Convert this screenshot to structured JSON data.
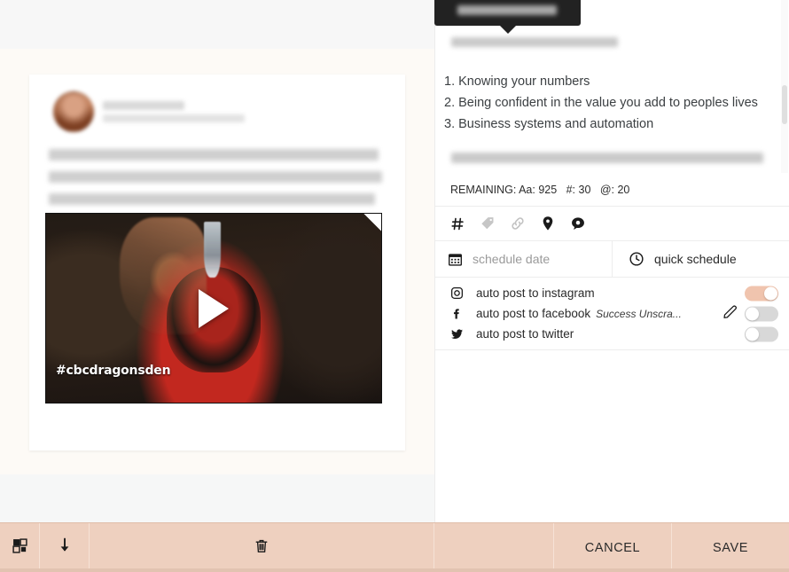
{
  "tooltip": {
    "label": "schedule post",
    "redacted": true
  },
  "left_panel": {
    "post_preview": {
      "author_name_redacted": true,
      "author_handle_redacted": true,
      "body_redacted": true,
      "media": {
        "type": "video",
        "hashtag_overlay": "#cbcdragonsden",
        "play_button": "play-triangle"
      }
    }
  },
  "right_panel": {
    "editor": {
      "intro_line_redacted": true,
      "list_items": [
        "1. Knowing your numbers",
        "2. Being confident in the value you add to peoples lives",
        "3. Business systems and automation"
      ],
      "closing_line_redacted": true
    },
    "remaining": {
      "prefix": "REMAINING:",
      "chars_label": "Aa:",
      "chars_value": "925",
      "hashtags_label": "#:",
      "hashtags_value": "30",
      "mentions_label": "@:",
      "mentions_value": "20",
      "full_text": "REMAINING: Aa: 925   #: 30   @: 20"
    },
    "insert_icons": [
      {
        "name": "hashtag-icon",
        "glyph": "#"
      },
      {
        "name": "tag-icon",
        "glyph": "tag"
      },
      {
        "name": "link-icon",
        "glyph": "link"
      },
      {
        "name": "location-pin-icon",
        "glyph": "pin"
      },
      {
        "name": "comment-icon",
        "glyph": "comment"
      }
    ],
    "schedule": {
      "date_placeholder": "schedule date",
      "quick_schedule_label": "quick schedule"
    },
    "auto_post": [
      {
        "network": "instagram",
        "label": "auto post to instagram",
        "sub": "",
        "enabled": true,
        "has_edit": false
      },
      {
        "network": "facebook",
        "label": "auto post to facebook",
        "sub": "Success Unscra...",
        "enabled": false,
        "has_edit": true
      },
      {
        "network": "twitter",
        "label": "auto post to twitter",
        "sub": "",
        "enabled": false,
        "has_edit": false
      }
    ]
  },
  "bottom_bar": {
    "duplicate_icon": "duplicate-icon",
    "download_icon": "download-arrow-icon",
    "delete_icon": "trash-icon",
    "cancel_label": "CANCEL",
    "save_label": "SAVE"
  },
  "colors": {
    "accent_toggle_on": "#f0c4ae",
    "bottom_bar": "#eed0bf",
    "left_panel_bg": "#fdfaf6",
    "text_primary": "#2a2a2a",
    "text_muted": "#9a9a9a"
  }
}
